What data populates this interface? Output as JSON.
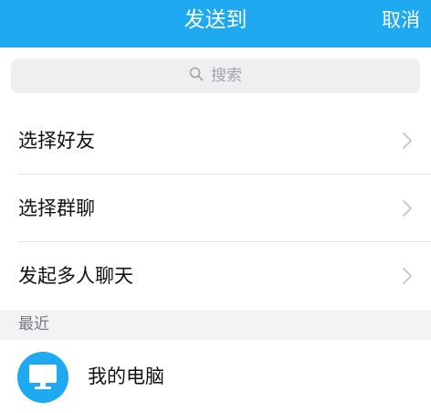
{
  "header": {
    "title": "发送到",
    "cancel_label": "取消"
  },
  "search": {
    "placeholder": "搜索",
    "icon": "search-icon"
  },
  "menu": {
    "items": [
      {
        "label": "选择好友",
        "icon": "chevron-right-icon"
      },
      {
        "label": "选择群聊",
        "icon": "chevron-right-icon"
      },
      {
        "label": "发起多人聊天",
        "icon": "chevron-right-icon"
      }
    ]
  },
  "recent": {
    "section_label": "最近",
    "items": [
      {
        "label": "我的电脑",
        "icon": "computer-monitor-icon"
      }
    ]
  },
  "colors": {
    "accent": "#1ea9f0",
    "search_bg": "#eeeff1",
    "section_bg": "#f3f3f5"
  }
}
